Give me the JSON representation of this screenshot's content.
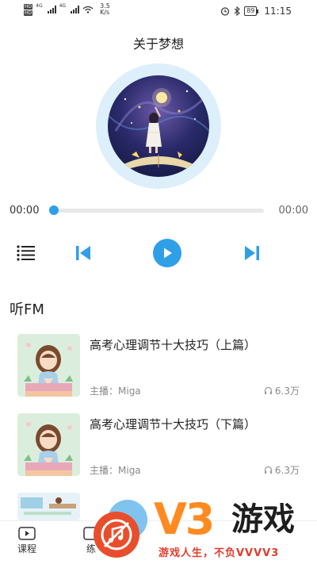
{
  "status_bar": {
    "hd1": "HD",
    "hd2": "HD",
    "net1": "4G",
    "net2": "4G",
    "speed_value": "3.5",
    "speed_unit": "K/s",
    "battery": "89",
    "time": "11:15"
  },
  "player": {
    "title": "关于梦想",
    "current_time": "00:00",
    "total_time": "00:00",
    "progress_fraction": 0.0
  },
  "section": {
    "title": "听FM"
  },
  "items": [
    {
      "title": "高考心理调节十大技巧（上篇）",
      "host": "主播：Miga",
      "plays": "6.3万"
    },
    {
      "title": "高考心理调节十大技巧（下篇）",
      "host": "主播：Miga",
      "plays": "6.3万"
    }
  ],
  "bottom_nav": {
    "courses_label": "课程",
    "second_label": "练"
  },
  "watermark": {
    "brand": "V3",
    "brand_cn": "游戏",
    "slogan": "游戏人生，不负VVVV3"
  },
  "colors": {
    "accent": "#2f9fe8",
    "disc_ring": "#dceffb",
    "watermark_orange": "#ff8a1f",
    "watermark_red": "#e23b2a"
  }
}
